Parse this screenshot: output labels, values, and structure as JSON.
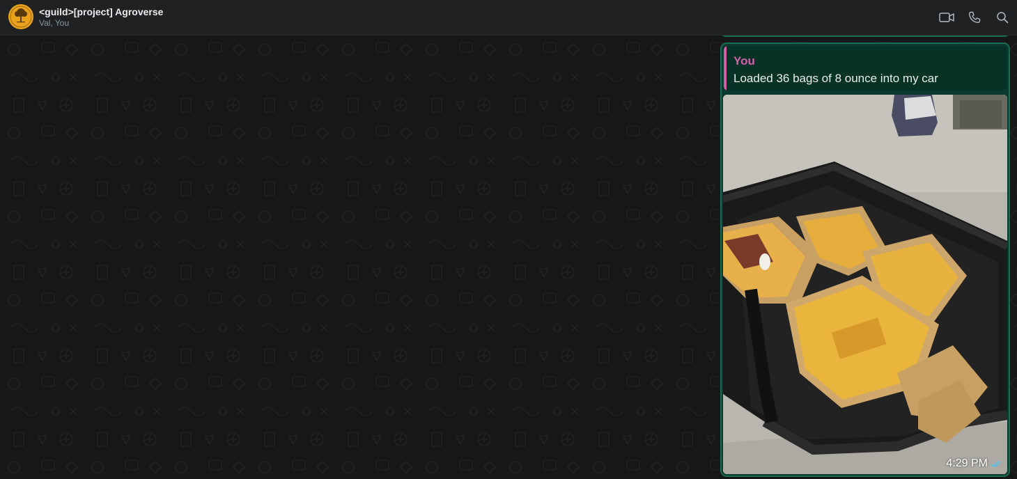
{
  "header": {
    "title": "<guild>[project] Agroverse",
    "subtitle": "Val, You",
    "avatar_icon": "tree-logo-icon",
    "actions": {
      "video": "video-call-icon",
      "voice": "voice-call-icon",
      "search": "search-icon"
    }
  },
  "message": {
    "quote_author": "You",
    "quote_text": "Loaded 36 bags of 8 ounce into my car",
    "time": "4:29 PM",
    "status_icon": "double-check-icon"
  },
  "colors": {
    "bubble": "#0a3b2e",
    "bubble_border": "#1a6b55",
    "quote_accent": "#d35fa8",
    "avatar": "#e8a21c",
    "read_check": "#53bdeb"
  }
}
